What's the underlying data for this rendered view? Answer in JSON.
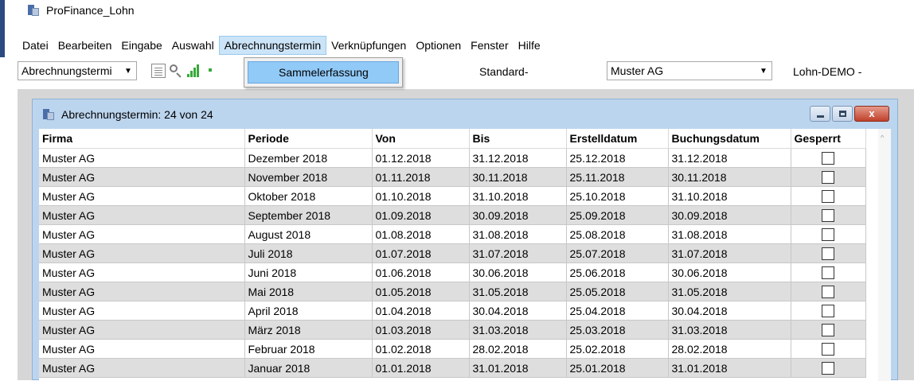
{
  "window": {
    "title": "ProFinance_Lohn"
  },
  "menu": [
    {
      "label": "Datei",
      "active": false
    },
    {
      "label": "Bearbeiten",
      "active": false
    },
    {
      "label": "Eingabe",
      "active": false
    },
    {
      "label": "Auswahl",
      "active": false
    },
    {
      "label": "Abrechnungstermin",
      "active": true
    },
    {
      "label": "Verknüpfungen",
      "active": false
    },
    {
      "label": "Optionen",
      "active": false
    },
    {
      "label": "Fenster",
      "active": false
    },
    {
      "label": "Hilfe",
      "active": false
    }
  ],
  "toolbar": {
    "view_select": "Abrechnungstermi",
    "icons": [
      "document-icon",
      "search-icon",
      "signal-icon"
    ],
    "standard_label": "Standard-",
    "company_select": "Muster AG",
    "mandant_label": "Lohn-DEMO -"
  },
  "dropdown": {
    "item": "Sammelerfassung"
  },
  "child_window": {
    "title": "Abrechnungstermin: 24 von 24",
    "close_label": "x"
  },
  "grid": {
    "columns": [
      "Firma",
      "Periode",
      "Von",
      "Bis",
      "Erstelldatum",
      "Buchungsdatum",
      "Gesperrt"
    ],
    "rows": [
      {
        "firma": "Muster AG",
        "periode": "Dezember 2018",
        "von": "01.12.2018",
        "bis": "31.12.2018",
        "erstell": "25.12.2018",
        "buchung": "31.12.2018",
        "gesperrt": false
      },
      {
        "firma": "Muster AG",
        "periode": "November 2018",
        "von": "01.11.2018",
        "bis": "30.11.2018",
        "erstell": "25.11.2018",
        "buchung": "30.11.2018",
        "gesperrt": false
      },
      {
        "firma": "Muster AG",
        "periode": "Oktober 2018",
        "von": "01.10.2018",
        "bis": "31.10.2018",
        "erstell": "25.10.2018",
        "buchung": "31.10.2018",
        "gesperrt": false
      },
      {
        "firma": "Muster AG",
        "periode": "September 2018",
        "von": "01.09.2018",
        "bis": "30.09.2018",
        "erstell": "25.09.2018",
        "buchung": "30.09.2018",
        "gesperrt": false
      },
      {
        "firma": "Muster AG",
        "periode": "August 2018",
        "von": "01.08.2018",
        "bis": "31.08.2018",
        "erstell": "25.08.2018",
        "buchung": "31.08.2018",
        "gesperrt": false
      },
      {
        "firma": "Muster AG",
        "periode": "Juli 2018",
        "von": "01.07.2018",
        "bis": "31.07.2018",
        "erstell": "25.07.2018",
        "buchung": "31.07.2018",
        "gesperrt": false
      },
      {
        "firma": "Muster AG",
        "periode": "Juni 2018",
        "von": "01.06.2018",
        "bis": "30.06.2018",
        "erstell": "25.06.2018",
        "buchung": "30.06.2018",
        "gesperrt": false
      },
      {
        "firma": "Muster AG",
        "periode": "Mai 2018",
        "von": "01.05.2018",
        "bis": "31.05.2018",
        "erstell": "25.05.2018",
        "buchung": "31.05.2018",
        "gesperrt": false
      },
      {
        "firma": "Muster AG",
        "periode": "April 2018",
        "von": "01.04.2018",
        "bis": "30.04.2018",
        "erstell": "25.04.2018",
        "buchung": "30.04.2018",
        "gesperrt": false
      },
      {
        "firma": "Muster AG",
        "periode": "März 2018",
        "von": "01.03.2018",
        "bis": "31.03.2018",
        "erstell": "25.03.2018",
        "buchung": "31.03.2018",
        "gesperrt": false
      },
      {
        "firma": "Muster AG",
        "periode": "Februar 2018",
        "von": "01.02.2018",
        "bis": "28.02.2018",
        "erstell": "25.02.2018",
        "buchung": "28.02.2018",
        "gesperrt": false
      },
      {
        "firma": "Muster AG",
        "periode": "Januar 2018",
        "von": "01.01.2018",
        "bis": "31.01.2018",
        "erstell": "25.01.2018",
        "buchung": "31.01.2018",
        "gesperrt": false
      }
    ]
  }
}
